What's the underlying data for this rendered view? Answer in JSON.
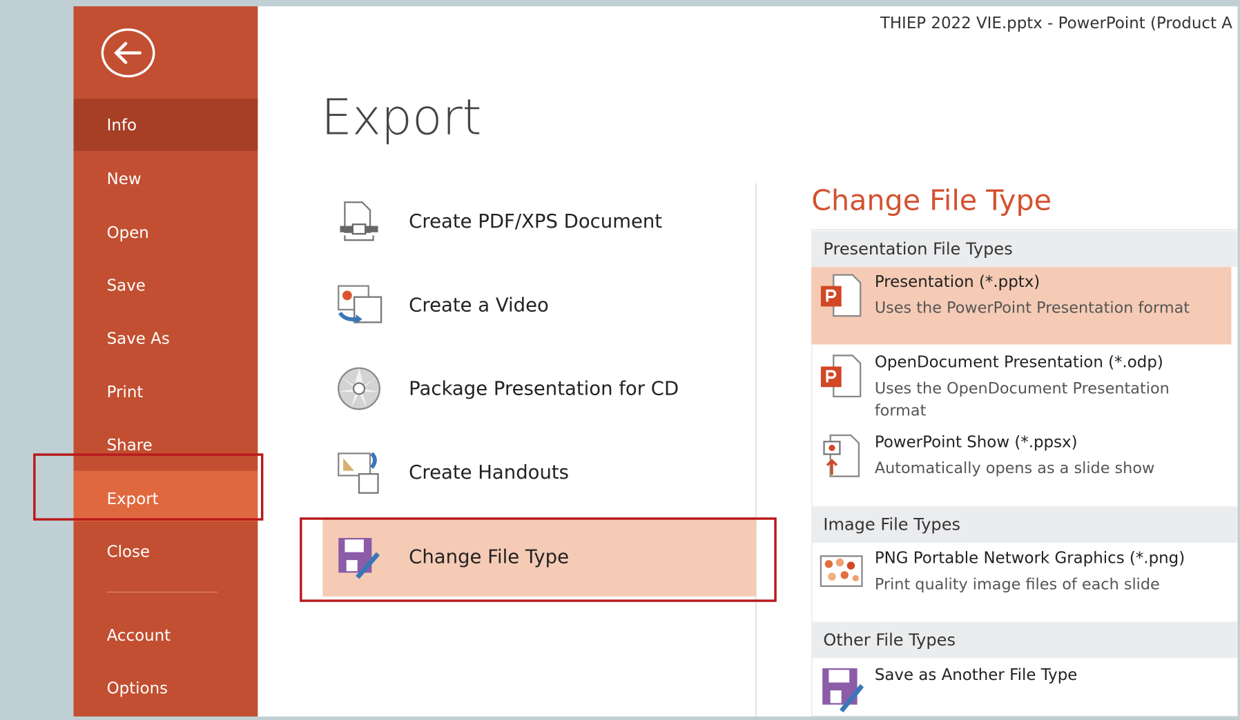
{
  "window_title": "THIEP 2022 VIE.pptx - PowerPoint (Product A",
  "sidebar": {
    "items": [
      {
        "label": "Info"
      },
      {
        "label": "New"
      },
      {
        "label": "Open"
      },
      {
        "label": "Save"
      },
      {
        "label": "Save As"
      },
      {
        "label": "Print"
      },
      {
        "label": "Share"
      },
      {
        "label": "Export"
      },
      {
        "label": "Close"
      },
      {
        "label": "Account"
      },
      {
        "label": "Options"
      }
    ],
    "selected": "Export"
  },
  "page_title": "Export",
  "export_options": [
    {
      "label": "Create PDF/XPS Document",
      "icon": "pdf-document-icon"
    },
    {
      "label": "Create a Video",
      "icon": "video-icon"
    },
    {
      "label": "Package Presentation for CD",
      "icon": "cd-icon"
    },
    {
      "label": "Create Handouts",
      "icon": "handouts-icon"
    },
    {
      "label": "Change File Type",
      "icon": "floppy-edit-icon",
      "selected": true
    }
  ],
  "panel": {
    "title": "Change File Type",
    "sections": [
      {
        "header": "Presentation File Types",
        "items": [
          {
            "name": "Presentation (*.pptx)",
            "desc": "Uses the PowerPoint Presentation format",
            "selected": true
          },
          {
            "name": "OpenDocument Presentation (*.odp)",
            "desc": "Uses the OpenDocument Presentation format"
          },
          {
            "name": "PowerPoint Show (*.ppsx)",
            "desc": "Automatically opens as a slide show"
          }
        ]
      },
      {
        "header": "Image File Types",
        "items": [
          {
            "name": "PNG Portable Network Graphics (*.png)",
            "desc": "Print quality image files of each slide"
          }
        ]
      },
      {
        "header": "Other File Types",
        "items": [
          {
            "name": "Save as Another File Type"
          }
        ]
      }
    ]
  },
  "colors": {
    "sidebar": "#c24f31",
    "sidebar_selected": "#a73f26",
    "sidebar_active": "#e0683f",
    "accent_title": "#d35230",
    "highlight": "#f5cbb5",
    "annotation_box": "#b8191c"
  }
}
